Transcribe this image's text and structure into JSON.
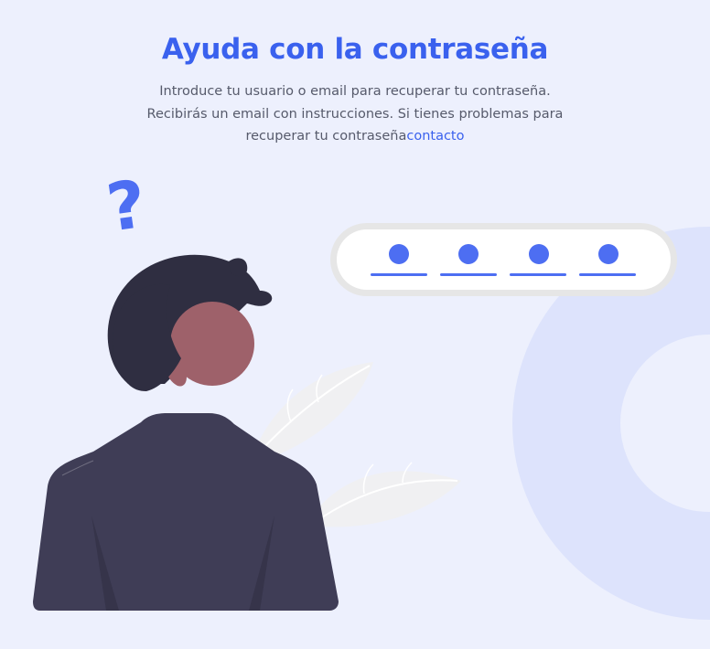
{
  "page": {
    "title": "Ayuda con la contraseña",
    "intro_line1": "Introduce tu usuario o email para recuperar tu contraseña.",
    "intro_line2": "Recibirás un email con instrucciones. Si tienes problemas para",
    "intro_line3": "recuperar tu contraseña",
    "contact_link": "contacto"
  },
  "illustration": {
    "question_mark": "?",
    "pin_dots_count": 4
  },
  "colors": {
    "background": "#edf0fd",
    "accent": "#3a61ee",
    "text": "#565a6b",
    "hair": "#2f2e41",
    "skin": "#9e616a",
    "jacket": "#3f3d56",
    "ring": "#dde3fc",
    "pin_dot": "#4d6ef2"
  }
}
